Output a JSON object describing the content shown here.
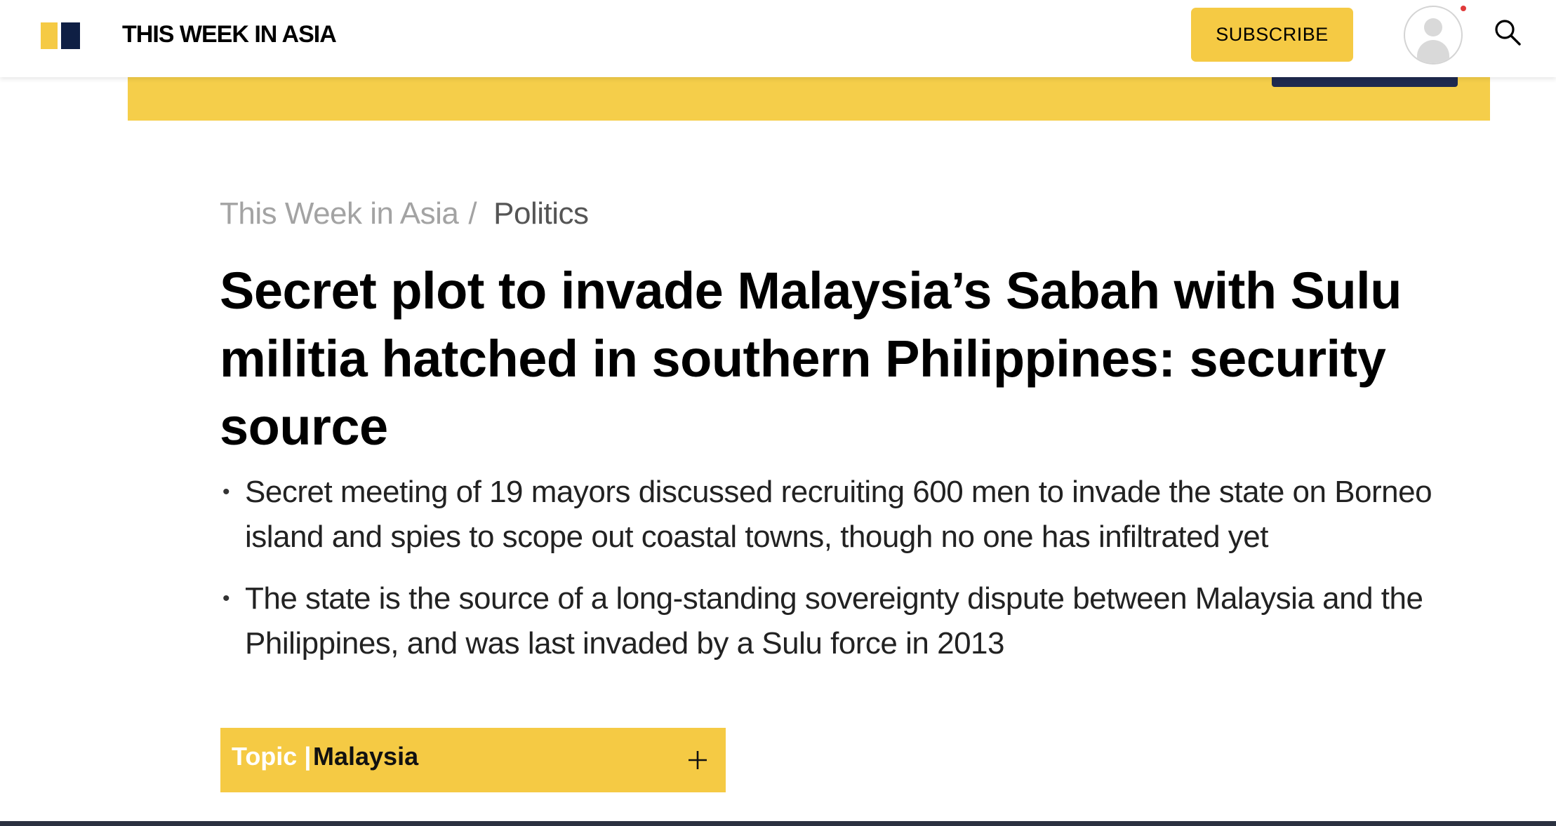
{
  "header": {
    "brand": "THIS WEEK IN ASIA",
    "subscribe_label": "SUBSCRIBE",
    "icons": {
      "logo": "brand-logo-icon",
      "avatar": "user-avatar-icon",
      "notification": "notification-dot-icon",
      "search": "search-icon"
    }
  },
  "breadcrumb": {
    "root": "This Week in Asia",
    "separator": "/",
    "current": "Politics"
  },
  "article": {
    "headline": "Secret plot to invade Malaysia’s Sabah with Sulu militia hatched in southern Philippines: security source",
    "summary": [
      "Secret meeting of 19 mayors discussed recruiting 600 men to invade the state on Borneo island and spies to scope out coastal towns, though no one has infiltrated yet",
      "The state is the source of a long-standing sovereignty dispute between Malaysia and the Philippines, and was last invaded by a Sulu force in 2013"
    ],
    "bullet_glyph": "•"
  },
  "topic": {
    "label": "Topic |",
    "value": "Malaysia",
    "expand_icon": "plus-icon"
  },
  "colors": {
    "accent_yellow": "#f5ca44",
    "brand_navy": "#0f1f44",
    "notification_red": "#e03a3a",
    "footer_bar": "#2b3140"
  }
}
